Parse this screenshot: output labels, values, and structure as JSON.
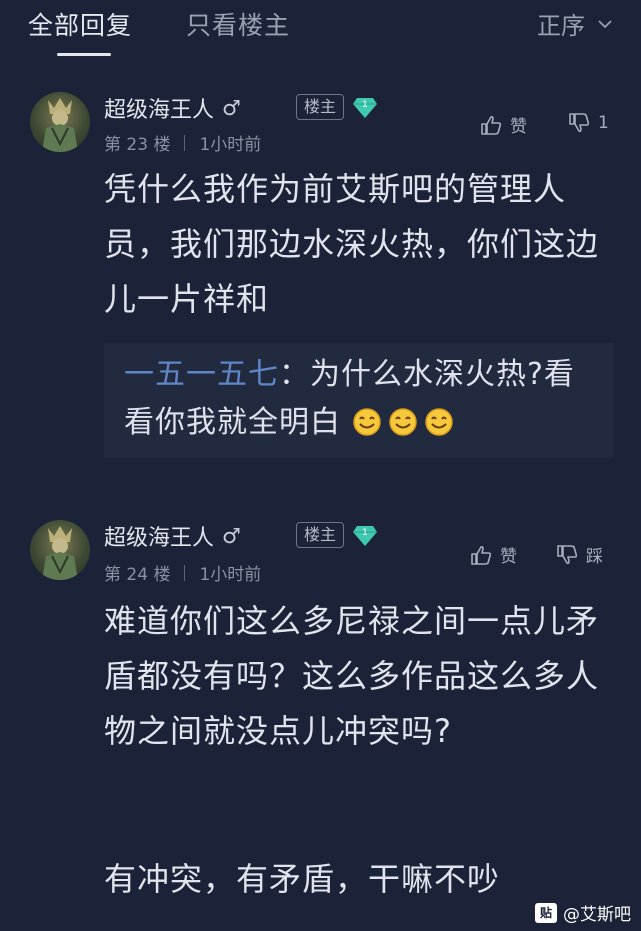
{
  "tabs": {
    "all_label": "全部回复",
    "owner_only_label": "只看楼主",
    "sort_label": "正序"
  },
  "posts": [
    {
      "username": "超级海王人",
      "gender": "♂",
      "owner_badge": "楼主",
      "level": "1",
      "floor": "第 23 楼",
      "time": "1小时前",
      "like_label": "赞",
      "dislike_label": "1",
      "content": "凭什么我作为前艾斯吧的管理人员，我们那边水深火热，你们这边儿一片祥和",
      "reply": {
        "author": "一五一五七",
        "colon": "：",
        "text": "为什么水深火热?看看你我就全明白"
      }
    },
    {
      "username": "超级海王人",
      "gender": "♂",
      "owner_badge": "楼主",
      "level": "1",
      "floor": "第 24 楼",
      "time": "1小时前",
      "like_label": "赞",
      "dislike_label": "踩",
      "content": "难道你们这么多尼禄之间一点儿矛盾都没有吗？这么多作品这么多人物之间就没点儿冲突吗?",
      "content2": "有冲突，有矛盾，干嘛不吵"
    }
  ],
  "watermark": {
    "box": "贴",
    "text": "@艾斯吧"
  },
  "colors": {
    "background": "#1c2338",
    "reply_box": "#222a40",
    "reply_author": "#5f87c8",
    "level_gem": "#3fc9b0"
  }
}
